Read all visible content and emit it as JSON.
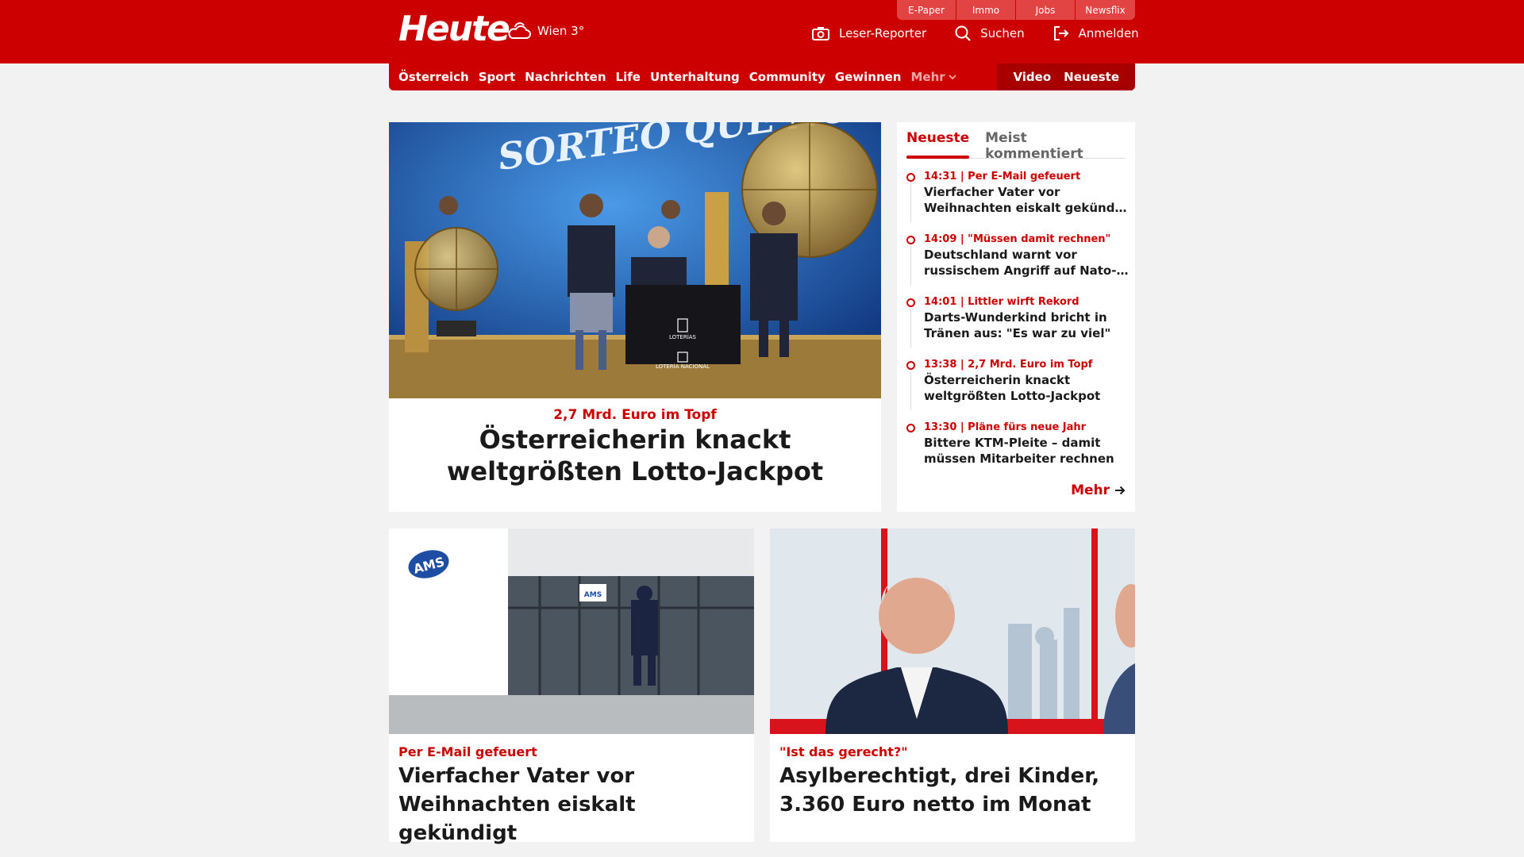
{
  "header": {
    "logo": "Heute",
    "weather": "Wien 3°",
    "top_links": [
      "E-Paper",
      "Immo",
      "Jobs",
      "Newsflix"
    ],
    "actions": {
      "reporter": "Leser-Reporter",
      "search": "Suchen",
      "login": "Anmelden"
    }
  },
  "nav": {
    "items": [
      "Österreich",
      "Sport",
      "Nachrichten",
      "Life",
      "Unterhaltung",
      "Community",
      "Gewinnen"
    ],
    "more": "Mehr",
    "video": "Video",
    "latest": "Neueste"
  },
  "hero": {
    "kicker": "2,7 Mrd. Euro im Topf",
    "title": "Österreicherin knackt weltgrößten Lotto-Jackpot",
    "image_text_banner": "SORTEO QUE NOS UNE",
    "image_text_podium1": "LOTERÍAS",
    "image_text_podium2": "LOTERÍA NACIONAL"
  },
  "sidebar": {
    "tabs": [
      "Neueste",
      "Meist kommentiert"
    ],
    "items": [
      {
        "meta": "14:31 | Per E-Mail gefeuert",
        "title1": "Vierfacher Vater vor",
        "title2": "Weihnachten eiskalt gekündigt"
      },
      {
        "meta": "14:09 | \"Müssen damit rechnen\"",
        "title1": "Deutschland warnt vor",
        "title2": "russischem Angriff auf Nato-..."
      },
      {
        "meta": "14:01 | Littler wirft Rekord",
        "title1": "Darts-Wunderkind bricht in",
        "title2": "Tränen aus: \"Es war zu viel\""
      },
      {
        "meta": "13:38 | 2,7 Mrd. Euro im Topf",
        "title1": "Österreicherin knackt",
        "title2": "weltgrößten Lotto-Jackpot"
      },
      {
        "meta": "13:30 | Pläne fürs neue Jahr",
        "title1": "Bittere KTM-Pleite – damit",
        "title2": "müssen Mitarbeiter rechnen"
      }
    ],
    "more": "Mehr"
  },
  "cards": [
    {
      "kicker": "Per E-Mail gefeuert",
      "title": "Vierfacher Vater vor Weihnachten eiskalt gekündigt",
      "image_logo": "AMS"
    },
    {
      "kicker": "\"Ist das gerecht?\"",
      "title": "Asylberechtigt, drei Kinder, 3.360 Euro netto im Monat"
    }
  ],
  "colors": {
    "brand": "#cc0000",
    "brand_dark": "#a80000",
    "background": "#f2f2f2"
  }
}
